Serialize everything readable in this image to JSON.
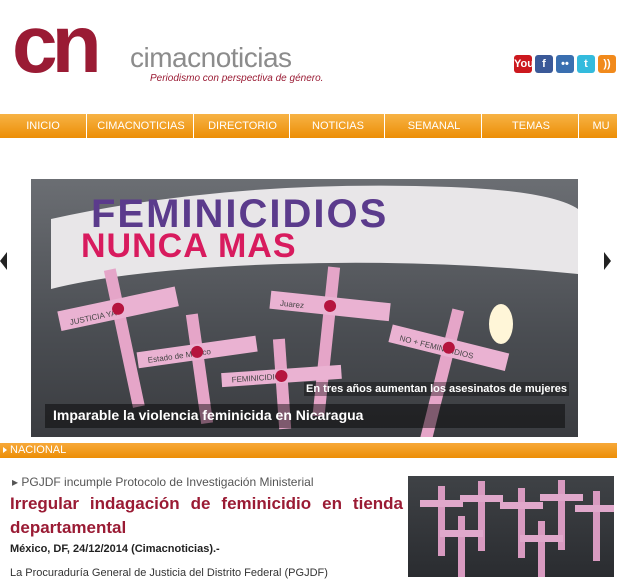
{
  "header": {
    "logo_mark": "cn",
    "site_name": "cimacnoticias",
    "tagline": "Periodismo con perspectiva de género."
  },
  "social": [
    {
      "name": "youtube",
      "label": "You",
      "color": "#cc181e"
    },
    {
      "name": "facebook",
      "label": "f",
      "color": "#3b5998"
    },
    {
      "name": "flickr",
      "label": "••",
      "color": "#3a6fb0"
    },
    {
      "name": "twitter",
      "label": "t",
      "color": "#33bbdd"
    },
    {
      "name": "rss",
      "label": "))",
      "color": "#f18a1c"
    }
  ],
  "nav": [
    "INICIO",
    "CIMACNOTICIAS",
    "DIRECTORIO",
    "NOTICIAS",
    "SEMANAL",
    "TEMAS",
    "MU"
  ],
  "slider": {
    "banner_line1": "FEMINICIDIOS",
    "banner_line2": "NUNCA MAS",
    "cross_labels": [
      "JUSTICIA YA",
      "Estado de México",
      "Juarez",
      "NO + FEMINICIDIOS",
      "FEMINICIDIO"
    ],
    "caption_small": "En tres años aumentan los asesinatos de mujeres",
    "caption_main": "Imparable la violencia feminicida en Nicaragua"
  },
  "section": {
    "label": "NACIONAL"
  },
  "article": {
    "kicker": "PGJDF incumple Protocolo de Investigación Ministerial",
    "headline": "Irregular indagación de feminicidio en tienda departamental",
    "dateline": "México, DF, 24/12/2014 (Cimacnoticias).-",
    "body_start": "La Procuraduría General de Justicia del Distrito Federal (PGJDF)"
  }
}
